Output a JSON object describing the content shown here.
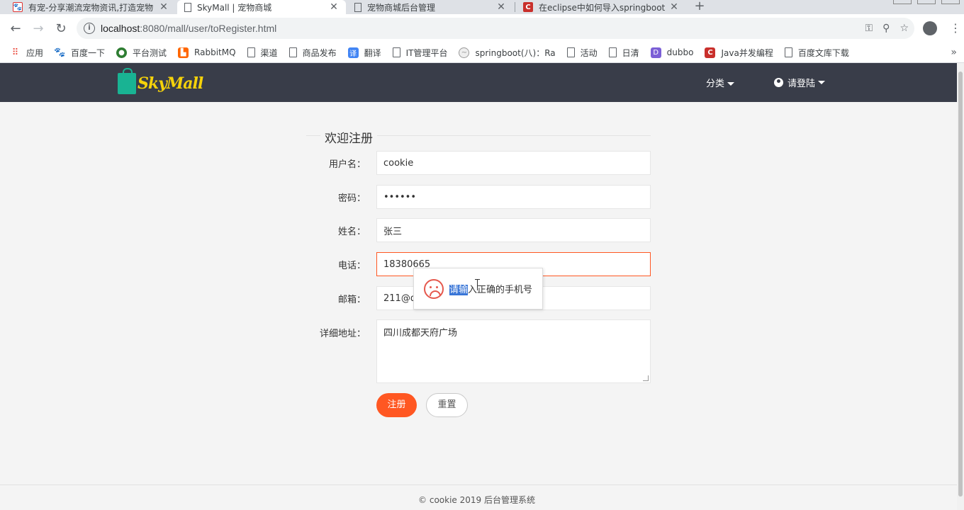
{
  "browser": {
    "tabs": [
      {
        "title": "有宠-分享潮流宠物资讯,打造宠物",
        "active": false,
        "icon": "paw-icon"
      },
      {
        "title": "SkyMall | 宠物商城",
        "active": true,
        "icon": "page-icon"
      },
      {
        "title": "宠物商城后台管理",
        "active": false,
        "icon": "page-icon"
      },
      {
        "title": "在eclipse中如何导入springboot",
        "active": false,
        "icon": "csdn-icon"
      }
    ],
    "new_tab": "+",
    "url_host": "localhost",
    "url_rest": ":8080/mall/user/toRegister.html",
    "bookmarks": [
      {
        "label": "应用",
        "icon": "apps-grid-icon"
      },
      {
        "label": "百度一下",
        "icon": "baidu-icon"
      },
      {
        "label": "平台测试",
        "icon": "platform-icon"
      },
      {
        "label": "RabbitMQ",
        "icon": "rabbitmq-icon"
      },
      {
        "label": "渠道",
        "icon": "page-icon"
      },
      {
        "label": "商品发布",
        "icon": "page-icon"
      },
      {
        "label": "翻译",
        "icon": "translate-icon"
      },
      {
        "label": "IT管理平台",
        "icon": "page-icon"
      },
      {
        "label": "springboot(八)：Ra",
        "icon": "springboot-icon"
      },
      {
        "label": "活动",
        "icon": "page-icon"
      },
      {
        "label": "日清",
        "icon": "page-icon"
      },
      {
        "label": "dubbo",
        "icon": "dubbo-icon"
      },
      {
        "label": "Java并发编程",
        "icon": "csdn-icon"
      },
      {
        "label": "百度文库下载",
        "icon": "page-icon"
      }
    ]
  },
  "site": {
    "logo_text": "SkyMall",
    "nav_category": "分类",
    "nav_login": "请登陆"
  },
  "form": {
    "legend": "欢迎注册",
    "fields": {
      "username": {
        "label": "用户名：",
        "value": "cookie"
      },
      "password": {
        "label": "密码：",
        "value": "••••••"
      },
      "name": {
        "label": "姓名：",
        "value": "张三"
      },
      "phone": {
        "label": "电话：",
        "value": "18380665"
      },
      "email": {
        "label": "邮箱：",
        "value": "211@qq"
      },
      "address": {
        "label": "详细地址：",
        "value": "四川成都天府广场"
      }
    },
    "submit_label": "注册",
    "reset_label": "重置",
    "error_tip": {
      "selected": "请输",
      "rest": "入正确的手机号"
    }
  },
  "footer": {
    "text": "© cookie 2019  后台管理系统"
  },
  "colors": {
    "header_bg": "#393d49",
    "primary": "#ff5722",
    "logo_yellow": "#f5d20a",
    "logo_green": "#19b393",
    "error_red": "#e5584d"
  }
}
